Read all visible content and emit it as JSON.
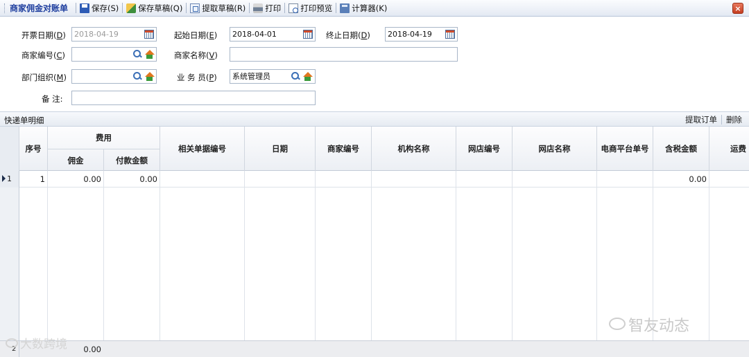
{
  "toolbar": {
    "title": "商家佣金对账单",
    "save": "保存(S)",
    "save_draft": "保存草稿(Q)",
    "fetch_draft": "提取草稿(R)",
    "print": "打印",
    "print_preview": "打印预览",
    "calculator": "计算器(K)",
    "close": "×"
  },
  "form": {
    "invoice_date": {
      "label": "开票日期",
      "hotkey": "D",
      "value": "2018-04-19"
    },
    "start_date": {
      "label": "起始日期",
      "hotkey": "E",
      "value": "2018-04-01"
    },
    "end_date": {
      "label": "终止日期",
      "hotkey": "D",
      "value": "2018-04-19"
    },
    "merchant_code": {
      "label": "商家编号",
      "hotkey": "C",
      "value": ""
    },
    "merchant_name": {
      "label": "商家名称",
      "hotkey": "V",
      "value": ""
    },
    "department": {
      "label": "部门组织",
      "hotkey": "M",
      "value": ""
    },
    "salesperson": {
      "label": "业 务 员",
      "hotkey": "P",
      "value": "系统管理员"
    },
    "remarks": {
      "label": "备 注:",
      "value": ""
    }
  },
  "detail": {
    "title": "快递单明细",
    "btn_fetch_order": "提取订单",
    "btn_delete": "删除",
    "columns": {
      "seq": "序号",
      "fee_group": "费用",
      "commission": "佣金",
      "payment": "付款金额",
      "related_doc": "相关单据编号",
      "date": "日期",
      "merchant_code": "商家编号",
      "org_name": "机构名称",
      "shop_code": "网店编号",
      "shop_name": "网店名称",
      "ec_order": "电商平台单号",
      "tax_amount": "含税金额",
      "shipping": "运费"
    },
    "rows": [
      {
        "row_index": "1",
        "seq": "1",
        "commission": "0.00",
        "payment": "0.00",
        "tax_amount": "0.00"
      }
    ],
    "total": {
      "row_index": "2",
      "commission": "0.00"
    }
  },
  "watermarks": {
    "brand_right": "智友动态",
    "brand_left": "大数跨境"
  }
}
